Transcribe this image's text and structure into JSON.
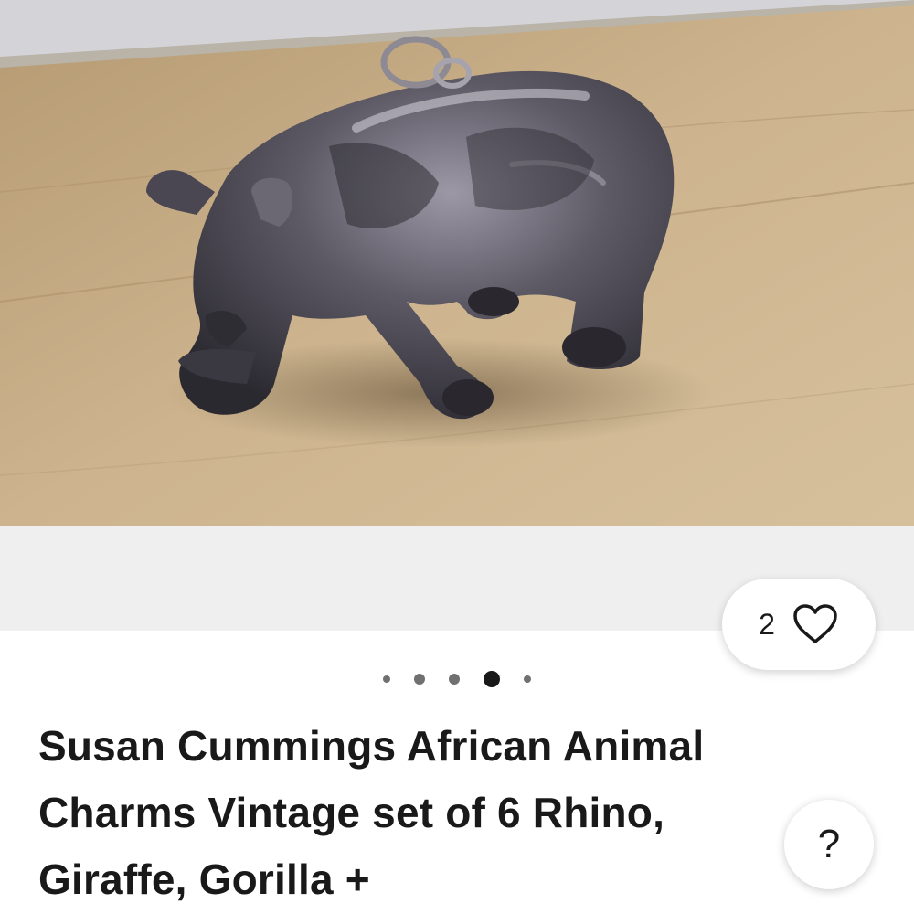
{
  "listing": {
    "title": "Susan Cummings African Animal Charms Vintage set of 6 Rhino, Giraffe, Gorilla +"
  },
  "gallery": {
    "image_description": "silver rhino charm on wooden table",
    "image_count": 5,
    "active_index": 3
  },
  "watch": {
    "count": "2",
    "icon": "heart-icon"
  },
  "help": {
    "label": "?",
    "icon": "help-icon"
  },
  "colors": {
    "text": "#191919",
    "gallery_bg": "#efefef",
    "active_dot": "#191919",
    "inactive_dot": "#707070"
  }
}
